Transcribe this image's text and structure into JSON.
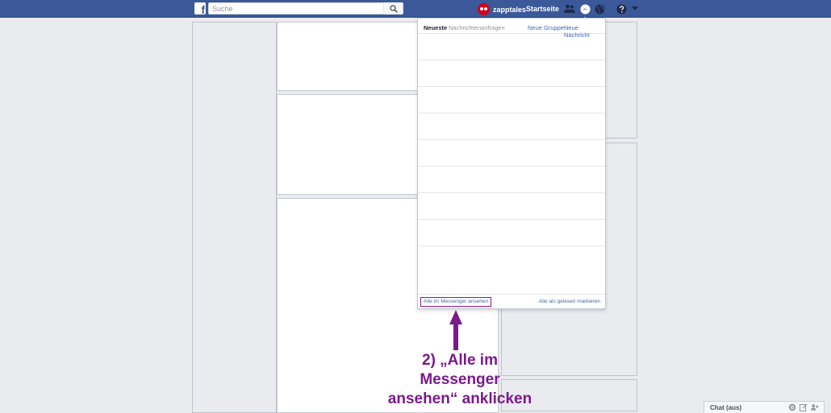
{
  "topbar": {
    "logo_letter": "f",
    "search_placeholder": "Suche",
    "profile_name": "zapptales",
    "home_label": "Startseite"
  },
  "messages_dropdown": {
    "tab_recent": "Neueste",
    "tab_requests": "Nachrichtenanfragen",
    "new_group": "Neue Gruppe",
    "separator": "·",
    "new_message": "Neue Nachricht",
    "see_all": "Alle im Messenger ansehen",
    "mark_all_read": "Alle als gelesen markieren"
  },
  "annotation": {
    "line1": "2) „Alle im",
    "line2": "Messenger",
    "line3": "ansehen“ anklicken",
    "color": "#7a1a8c"
  },
  "chat": {
    "label": "Chat (aus)"
  },
  "colors": {
    "brand": "#3b5998",
    "link": "#4267b2",
    "background": "#e9ebee"
  }
}
